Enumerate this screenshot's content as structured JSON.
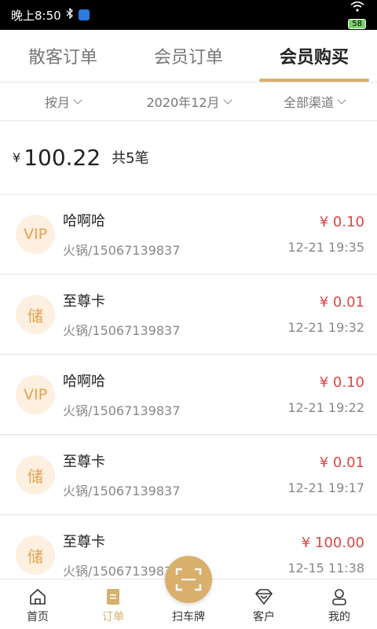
{
  "status": {
    "time": "晚上8:50",
    "battery": "58"
  },
  "tabs": [
    {
      "label": "散客订单"
    },
    {
      "label": "会员订单"
    },
    {
      "label": "会员购买"
    }
  ],
  "filters": [
    {
      "label": "按月"
    },
    {
      "label": "2020年12月"
    },
    {
      "label": "全部渠道"
    }
  ],
  "summary": {
    "yen": "¥",
    "total": "100.22",
    "count": "共5笔"
  },
  "orders": [
    {
      "badge": "VIP",
      "name": "哈啊哈",
      "sub": "火锅/15067139837",
      "amount": "¥ 0.10",
      "time": "12-21 19:35"
    },
    {
      "badge": "储",
      "name": "至尊卡",
      "sub": "火锅/15067139837",
      "amount": "¥ 0.01",
      "time": "12-21 19:32"
    },
    {
      "badge": "VIP",
      "name": "哈啊哈",
      "sub": "火锅/15067139837",
      "amount": "¥ 0.10",
      "time": "12-21 19:22"
    },
    {
      "badge": "储",
      "name": "至尊卡",
      "sub": "火锅/15067139837",
      "amount": "¥ 0.01",
      "time": "12-21 19:17"
    },
    {
      "badge": "储",
      "name": "至尊卡",
      "sub": "火锅/1506713983",
      "amount": "¥ 100.00",
      "time": "12-15 11:38"
    }
  ],
  "nav": [
    {
      "label": "首页",
      "icon": "home-icon"
    },
    {
      "label": "订单",
      "icon": "order-icon"
    },
    {
      "label": "扫车牌",
      "icon": "scan-icon"
    },
    {
      "label": "客户",
      "icon": "diamond-icon"
    },
    {
      "label": "我的",
      "icon": "user-icon"
    }
  ],
  "colors": {
    "accent": "#d4b16c",
    "amount": "#e04545",
    "badge_bg": "#fdf0e1",
    "badge_fg": "#e8a24b"
  }
}
